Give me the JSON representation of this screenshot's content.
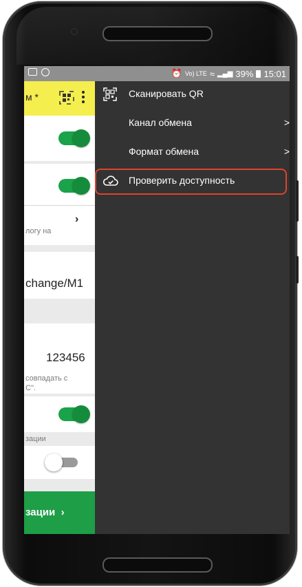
{
  "status": {
    "battery": "39%",
    "time": "15:01",
    "volte": "Vo) LTE"
  },
  "app": {
    "title": "м *",
    "text_lines": [
      "логу на",
      "change/M1",
      "123456",
      "совпадать с",
      "С\".",
      "зации"
    ],
    "button_label": "зации"
  },
  "menu": {
    "items": [
      {
        "label": "Сканировать QR",
        "icon": "qr-icon"
      },
      {
        "label": "Канал обмена",
        "icon": ""
      },
      {
        "label": "Формат обмена",
        "icon": ""
      },
      {
        "label": "Проверить доступность",
        "icon": "cloud-check-icon"
      }
    ],
    "chevron": ">",
    "highlight_color": "#e0442b"
  },
  "colors": {
    "app_bar": "#f5ee4f",
    "accent_green": "#1aa34a",
    "menu_bg": "#333333"
  }
}
